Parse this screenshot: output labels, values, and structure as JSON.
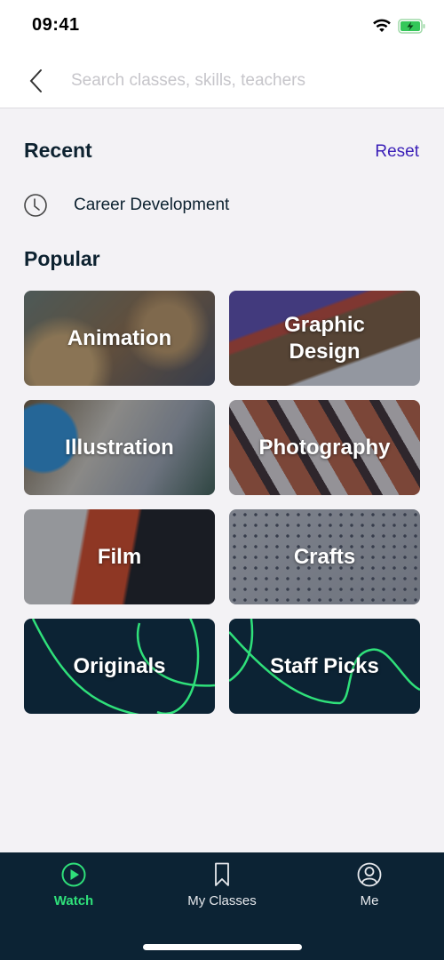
{
  "status_bar": {
    "time": "09:41",
    "wifi_icon": "wifi-icon",
    "battery_icon": "battery-charging-icon"
  },
  "search": {
    "back_icon": "chevron-left-icon",
    "placeholder": "Search classes, skills, teachers",
    "value": ""
  },
  "recent": {
    "title": "Recent",
    "reset_label": "Reset",
    "items": [
      {
        "icon": "clock-icon",
        "label": "Career Development"
      }
    ]
  },
  "popular": {
    "title": "Popular",
    "tiles": [
      {
        "label": "Animation"
      },
      {
        "label": "Graphic\nDesign"
      },
      {
        "label": "Illustration"
      },
      {
        "label": "Photography"
      },
      {
        "label": "Film"
      },
      {
        "label": "Crafts"
      },
      {
        "label": "Originals"
      },
      {
        "label": "Staff Picks"
      }
    ]
  },
  "tab_bar": {
    "tabs": [
      {
        "label": "Watch",
        "icon": "play-circle-icon",
        "active": true
      },
      {
        "label": "My Classes",
        "icon": "bookmark-icon",
        "active": false
      },
      {
        "label": "Me",
        "icon": "profile-icon",
        "active": false
      }
    ]
  },
  "colors": {
    "accent": "#2fe07a",
    "link": "#3a1fb8",
    "navy": "#0c2334",
    "background": "#f3f2f5"
  }
}
